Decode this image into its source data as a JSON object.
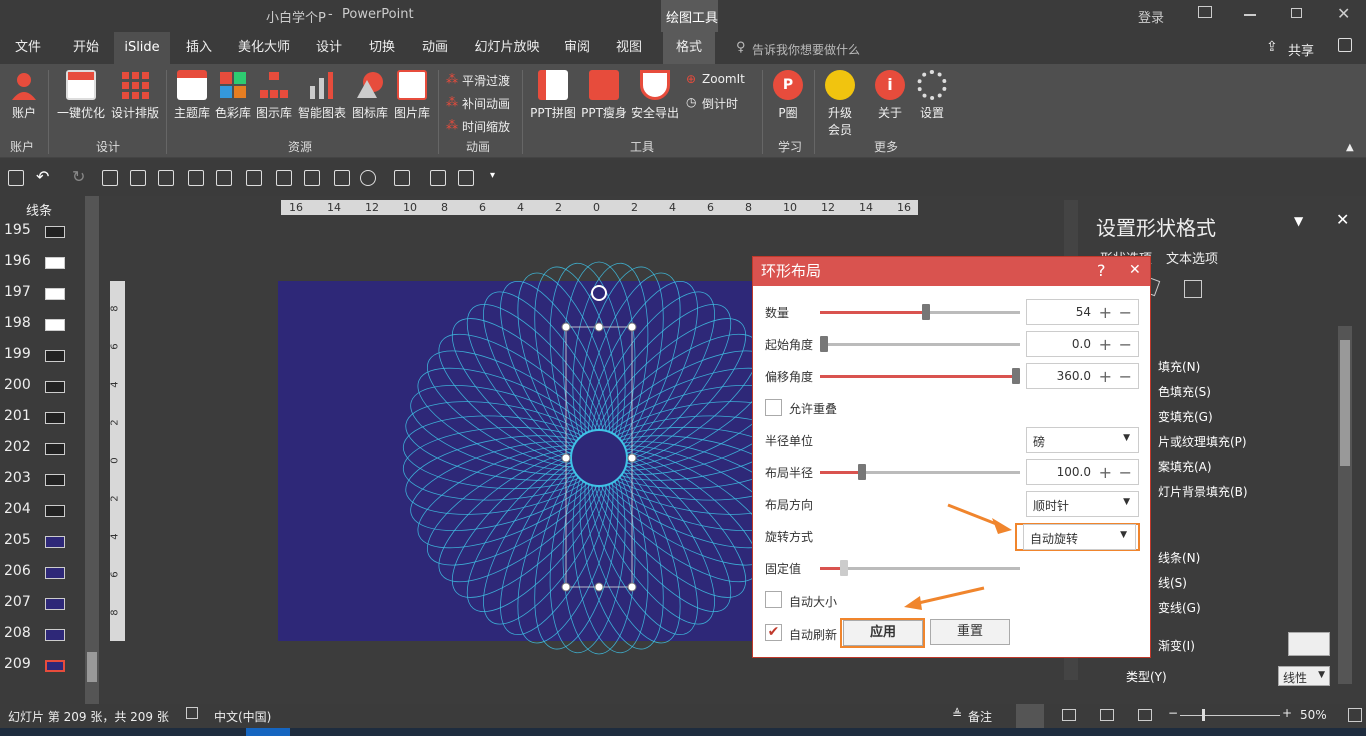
{
  "title": {
    "doc": "小白学个P",
    "sep": "-",
    "app": "PowerPoint",
    "context_tab": "绘图工具",
    "login": "登录"
  },
  "tabs": [
    "文件",
    "开始",
    "iSlide",
    "插入",
    "美化大师",
    "设计",
    "切换",
    "动画",
    "幻灯片放映",
    "审阅",
    "视图",
    "格式"
  ],
  "tell_me": "告诉我你想要做什么",
  "share": "共享",
  "ribbon": {
    "account": "账户",
    "one_click": "一键优化",
    "design_layout": "设计排版",
    "theme_lib": "主题库",
    "color_lib": "色彩库",
    "diagram_lib": "图示库",
    "smart_chart": "智能图表",
    "icon_lib": "图标库",
    "pic_lib": "图片库",
    "smooth": "平滑过渡",
    "tween": "补间动画",
    "time_scale": "时间缩放",
    "ppt_puzzle": "PPT拼图",
    "ppt_slim": "PPT瘦身",
    "safe_export": "安全导出",
    "zoomit": "ZoomIt",
    "countdown": "倒计时",
    "p_circle": "P圈",
    "upgrade1": "升级",
    "upgrade2": "会员",
    "about": "关于",
    "settings": "设置",
    "groups": {
      "account": "账户",
      "design": "设计",
      "resources": "资源",
      "animation": "动画",
      "tools": "工具",
      "learn": "学习",
      "more": "更多"
    }
  },
  "thumbs": {
    "header": "线条",
    "numbers": [
      "195",
      "196",
      "197",
      "198",
      "199",
      "200",
      "201",
      "202",
      "203",
      "204",
      "205",
      "206",
      "207",
      "208",
      "209"
    ]
  },
  "ruler_h": [
    "16",
    "14",
    "12",
    "10",
    "8",
    "6",
    "4",
    "2",
    "0",
    "2",
    "4",
    "6",
    "8",
    "10",
    "12",
    "14",
    "16"
  ],
  "ruler_v": [
    "8",
    "6",
    "4",
    "2",
    "0",
    "2",
    "4",
    "6",
    "8"
  ],
  "panel": {
    "title": "设置形状格式",
    "tab1": "形状选项",
    "tab2": "文本选项",
    "options": [
      "填充(N)",
      "色填充(S)",
      "变填充(G)",
      "片或纹理填充(P)",
      "案填充(A)",
      "灯片背景填充(B)",
      "线条(N)",
      "线(S)",
      "变线(G)"
    ],
    "gradient": "渐变(I)",
    "type_label": "类型(Y)",
    "type_value": "线性"
  },
  "dialog": {
    "title": "环形布局",
    "help": "?",
    "close": "✕",
    "count_label": "数量",
    "count_value": "54",
    "count_fraction": 0.53,
    "start_label": "起始角度",
    "start_value": "0.0",
    "start_fraction": 0.0,
    "offset_label": "偏移角度",
    "offset_value": "360.0",
    "offset_fraction": 1.0,
    "overlap_label": "允许重叠",
    "radius_unit_label": "半径单位",
    "radius_unit_value": "磅",
    "radius_label": "布局半径",
    "radius_value": "100.0",
    "radius_fraction": 0.21,
    "direction_label": "布局方向",
    "direction_value": "顺时针",
    "rotation_label": "旋转方式",
    "rotation_value": "自动旋转",
    "fixed_label": "固定值",
    "fixed_fraction": 0.12,
    "autosize_label": "自动大小",
    "autorefresh_label": "自动刷新",
    "apply": "应用",
    "reset": "重置"
  },
  "status": {
    "slide_info": "幻灯片 第 209 张，共 209 张",
    "lang": "中文(中国)",
    "notes": "备注",
    "zoom": "50%"
  },
  "colors": {
    "accent": "#d9534f",
    "slide_bg": "#2e2878",
    "highlight": "#f0852d",
    "rings": "#3fc3e6"
  }
}
